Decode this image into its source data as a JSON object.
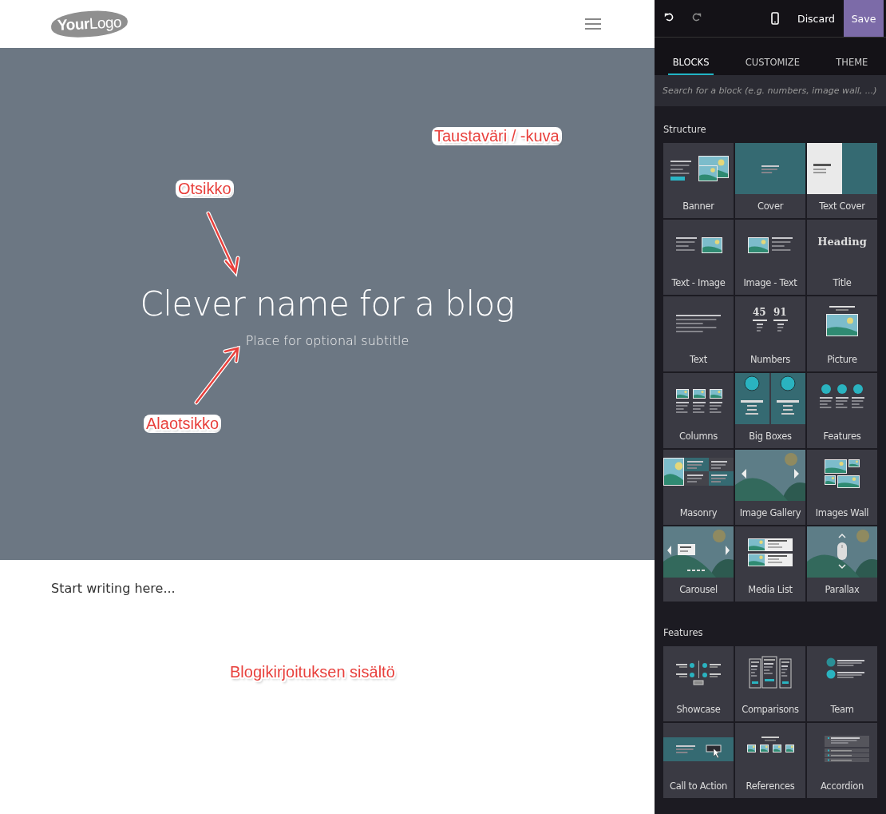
{
  "header": {
    "logo": "**Your**Logo"
  },
  "hero": {
    "title": "Clever name for a blog",
    "subtitle": "Place for optional subtitle"
  },
  "content": {
    "placeholder": "Start writing here..."
  },
  "annotations": {
    "background": "Taustaväri / -kuva",
    "title": "Otsikko",
    "subtitle": "Alaotsikko",
    "content": "Blogikirjoituksen sisältö"
  },
  "editor": {
    "undo_disabled": false,
    "redo_disabled": true,
    "discard": "Discard",
    "save": "Save",
    "tabs": [
      {
        "label": "BLOCKS",
        "selected": true
      },
      {
        "label": "CUSTOMIZE",
        "selected": false
      },
      {
        "label": "THEME",
        "selected": false
      }
    ],
    "search": {
      "placeholder": "Search for a block (e.g. numbers, image wall, ...)"
    },
    "sections": [
      {
        "title": "Structure",
        "blocks": [
          {
            "label": "Banner",
            "kind": "banner"
          },
          {
            "label": "Cover",
            "kind": "cover"
          },
          {
            "label": "Text Cover",
            "kind": "text-cover"
          },
          {
            "label": "Text - Image",
            "kind": "text-image"
          },
          {
            "label": "Image - Text",
            "kind": "image-text"
          },
          {
            "label": "Title",
            "kind": "title",
            "thumb_text": [
              "Heading"
            ]
          },
          {
            "label": "Text",
            "kind": "text"
          },
          {
            "label": "Numbers",
            "kind": "numbers",
            "thumb_text": [
              "45",
              "91"
            ]
          },
          {
            "label": "Picture",
            "kind": "picture"
          },
          {
            "label": "Columns",
            "kind": "columns"
          },
          {
            "label": "Big Boxes",
            "kind": "big-boxes"
          },
          {
            "label": "Features",
            "kind": "features"
          },
          {
            "label": "Masonry",
            "kind": "masonry"
          },
          {
            "label": "Image Gallery",
            "kind": "gallery"
          },
          {
            "label": "Images Wall",
            "kind": "images-wall"
          },
          {
            "label": "Carousel",
            "kind": "carousel"
          },
          {
            "label": "Media List",
            "kind": "media-list"
          },
          {
            "label": "Parallax",
            "kind": "parallax"
          }
        ]
      },
      {
        "title": "Features",
        "blocks": [
          {
            "label": "Showcase",
            "kind": "showcase"
          },
          {
            "label": "Comparisons",
            "kind": "comparisons"
          },
          {
            "label": "Team",
            "kind": "team"
          },
          {
            "label": "Call to Action",
            "kind": "cta"
          },
          {
            "label": "References",
            "kind": "references"
          },
          {
            "label": "Accordion",
            "kind": "accordion"
          }
        ]
      }
    ]
  }
}
